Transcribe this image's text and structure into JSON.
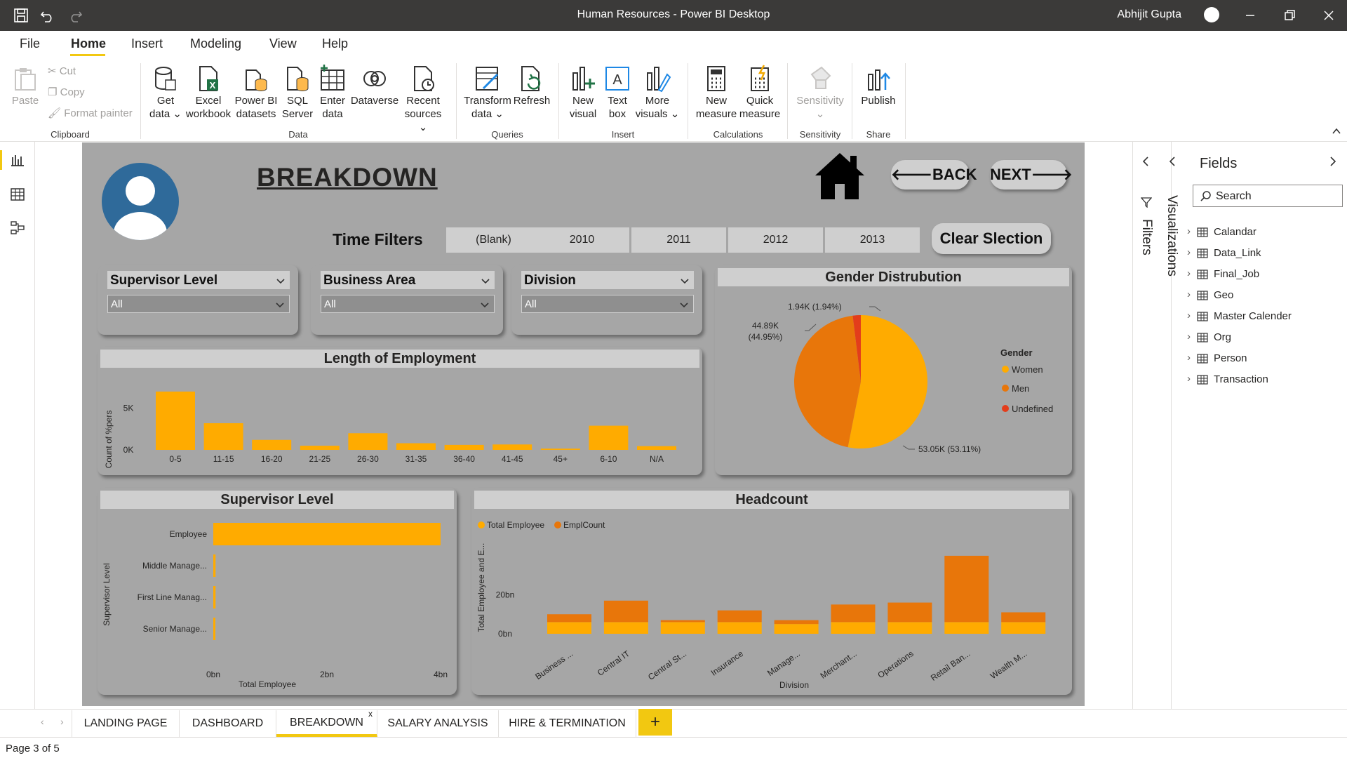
{
  "window": {
    "title": "Human Resources - Power BI Desktop",
    "user": "Abhijit Gupta"
  },
  "menu": {
    "items": [
      "File",
      "Home",
      "Insert",
      "Modeling",
      "View",
      "Help"
    ],
    "active": "Home"
  },
  "ribbon": {
    "clipboard": {
      "paste": "Paste",
      "cut": "Cut",
      "copy": "Copy",
      "format_painter": "Format painter",
      "group": "Clipboard"
    },
    "data": {
      "get_data": [
        "Get",
        "data"
      ],
      "excel": [
        "Excel",
        "workbook"
      ],
      "pbi_datasets": [
        "Power BI",
        "datasets"
      ],
      "sql": [
        "SQL",
        "Server"
      ],
      "enter": [
        "Enter",
        "data"
      ],
      "dataverse": "Dataverse",
      "recent": [
        "Recent",
        "sources"
      ],
      "group": "Data"
    },
    "queries": {
      "transform": [
        "Transform",
        "data"
      ],
      "refresh": "Refresh",
      "group": "Queries"
    },
    "insert": {
      "new_visual": [
        "New",
        "visual"
      ],
      "text_box": [
        "Text",
        "box"
      ],
      "more_visuals": [
        "More",
        "visuals"
      ],
      "group": "Insert"
    },
    "calculations": {
      "new_measure": [
        "New",
        "measure"
      ],
      "quick_measure": [
        "Quick",
        "measure"
      ],
      "group": "Calculations"
    },
    "sensitivity": {
      "label": "Sensitivity",
      "group": "Sensitivity"
    },
    "share": {
      "publish": "Publish",
      "group": "Share"
    }
  },
  "report": {
    "title": "BREAKDOWN",
    "back": "BACK",
    "next": "NEXT",
    "time_filters_label": "Time Filters",
    "time_filters": [
      "(Blank)",
      "2010",
      "2011",
      "2012",
      "2013"
    ],
    "clear": "Clear Slection",
    "slicers": [
      {
        "label": "Supervisor Level",
        "value": "All"
      },
      {
        "label": "Business Area",
        "value": "All"
      },
      {
        "label": "Division",
        "value": "All"
      }
    ]
  },
  "colors": {
    "orange": "#ffab00",
    "dark_orange": "#e8760a",
    "red": "#e33d1b",
    "canvas": "#a6a6a6",
    "accent": "#f2c811"
  },
  "chart_data": [
    {
      "type": "bar",
      "title": "Length of Employment",
      "ylabel": "Count of %pers",
      "xlabel": "",
      "categories": [
        "0-5",
        "11-15",
        "16-20",
        "21-25",
        "26-30",
        "31-35",
        "36-40",
        "41-45",
        "45+",
        "6-10",
        "N/A"
      ],
      "values": [
        7000,
        3200,
        1200,
        500,
        2000,
        800,
        600,
        650,
        150,
        2900,
        450
      ],
      "yticks": [
        "0K",
        "5K"
      ],
      "ylim": [
        0,
        8000
      ]
    },
    {
      "type": "pie",
      "title": "Gender Distrubution",
      "legend_title": "Gender",
      "legend_position": "right",
      "slices": [
        {
          "label": "Women",
          "value": 53.05,
          "display": "53.05K (53.11%)",
          "color": "#ffab00"
        },
        {
          "label": "Men",
          "value": 44.89,
          "display_lines": [
            "44.89K",
            "(44.95%)"
          ],
          "color": "#e8760a"
        },
        {
          "label": "Undefined",
          "value": 1.94,
          "display": "1.94K (1.94%)",
          "color": "#e33d1b"
        }
      ]
    },
    {
      "type": "bar",
      "orientation": "horizontal",
      "title": "Supervisor Level",
      "ylabel": "Supervisor Level",
      "xlabel": "Total Employee",
      "categories": [
        "Employee",
        "Middle Manage...",
        "First Line Manag...",
        "Senior Manage..."
      ],
      "values": [
        4.0,
        0.04,
        0.04,
        0.02
      ],
      "xticks": [
        "0bn",
        "2bn",
        "4bn"
      ],
      "xlim": [
        0,
        4
      ]
    },
    {
      "type": "bar",
      "stacked": true,
      "title": "Headcount",
      "ylabel": "Total Employee and E...",
      "xlabel": "Division",
      "legend_position": "top-left",
      "categories": [
        "Business ...",
        "Central IT",
        "Central St...",
        "Insurance",
        "Manage...",
        "Merchant...",
        "Operations",
        "Retail Ban...",
        "Wealth M..."
      ],
      "series": [
        {
          "name": "Total Employee",
          "values": [
            6,
            6,
            6,
            6,
            5,
            6,
            6,
            6,
            6
          ],
          "color": "#ffab00"
        },
        {
          "name": "EmplCount",
          "values": [
            4,
            11,
            1,
            6,
            2,
            9,
            10,
            34,
            5
          ],
          "color": "#e8760a"
        }
      ],
      "yticks": [
        "0bn",
        "20bn"
      ],
      "ylim": [
        0,
        45
      ]
    }
  ],
  "panes": {
    "filters": "Filters",
    "visualizations": "Visualizations",
    "fields_title": "Fields",
    "search_placeholder": "Search",
    "tables": [
      "Calandar",
      "Data_Link",
      "Final_Job",
      "Geo",
      "Master Calender",
      "Org",
      "Person",
      "Transaction"
    ]
  },
  "tabs": {
    "items": [
      "LANDING PAGE",
      "DASHBOARD",
      "BREAKDOWN",
      "SALARY ANALYSIS",
      "HIRE & TERMINATION"
    ],
    "active": "BREAKDOWN",
    "add": "+",
    "close": "x"
  },
  "status": {
    "page": "Page 3 of 5"
  }
}
